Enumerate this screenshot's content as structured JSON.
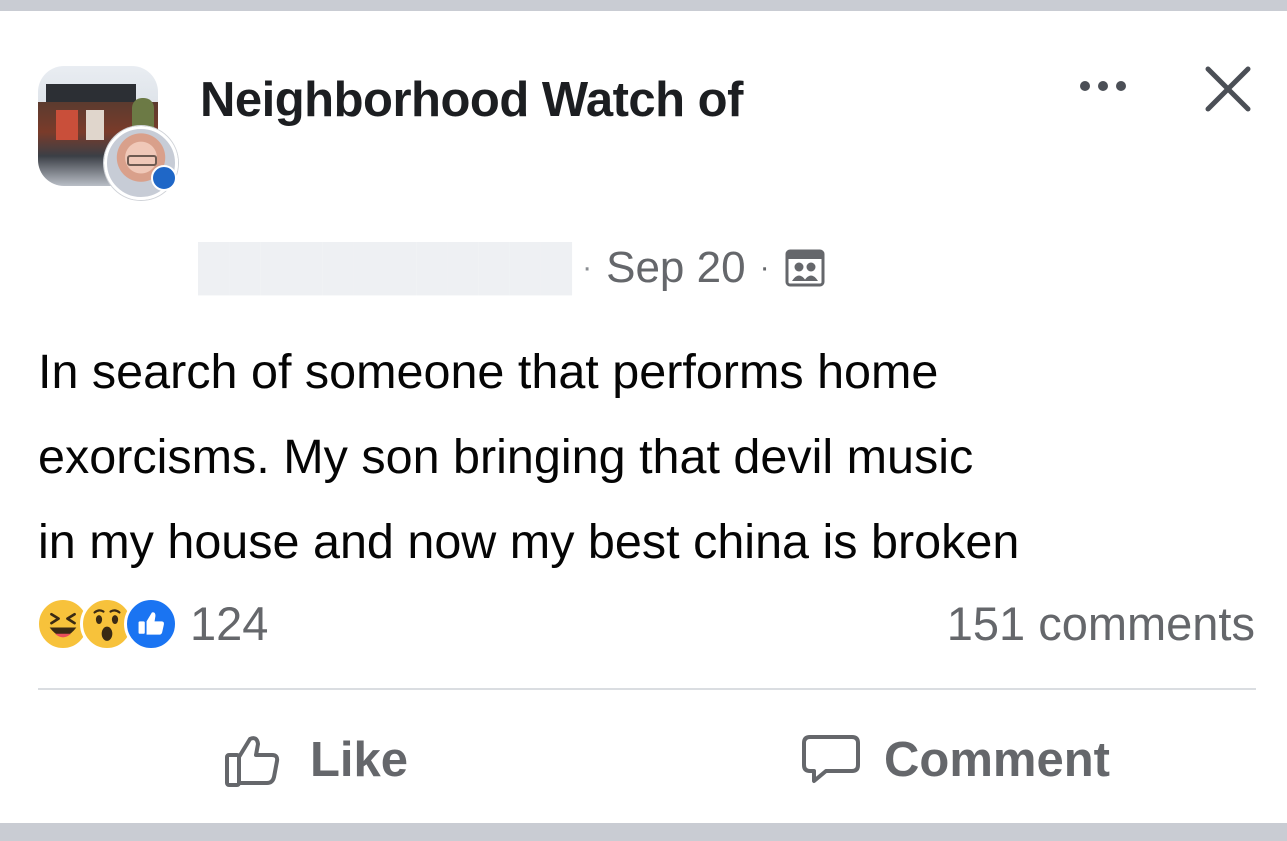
{
  "post": {
    "group_name": "Neighborhood Watch of",
    "date": "Sep 20",
    "separator": "·",
    "body_lines": [
      "In search of someone that performs home",
      "exorcisms. My son bringing that devil music",
      "in my house and now my best china is broken"
    ]
  },
  "icons": {
    "more": "more-options-icon",
    "close": "close-icon",
    "privacy": "group-members-icon",
    "reactions": [
      "haha-icon",
      "wow-icon",
      "like-icon"
    ],
    "like": "thumbs-up-icon",
    "comment": "comment-bubble-icon"
  },
  "stats": {
    "reaction_count": "124",
    "comments_label": "151 comments"
  },
  "actions": {
    "like_label": "Like",
    "comment_label": "Comment"
  },
  "colors": {
    "like_blue": "#1a74f2",
    "emoji_yellow": "#f7c23b",
    "secondary_text": "#65676b",
    "frame_bar": "#c9ccd3"
  }
}
